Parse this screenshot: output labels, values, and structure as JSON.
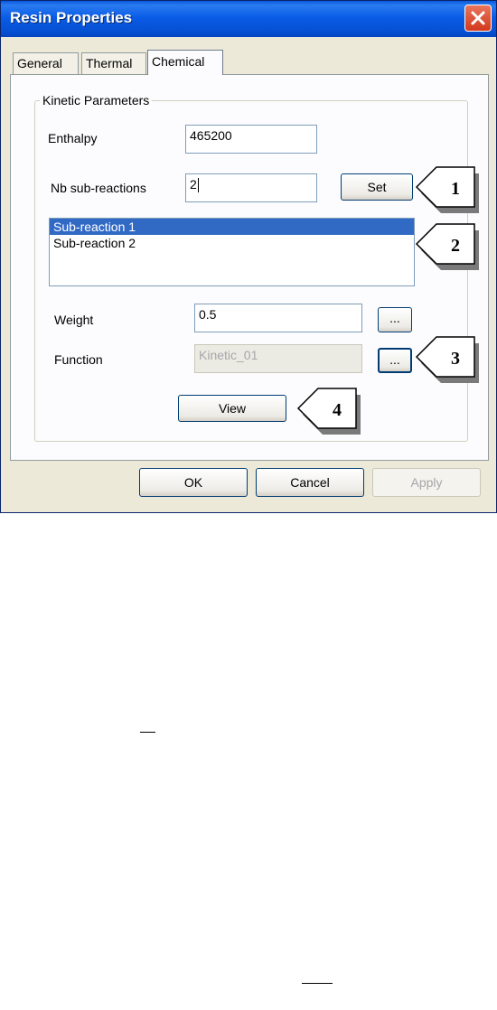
{
  "window": {
    "title": "Resin Properties"
  },
  "tabs": [
    {
      "label": "General"
    },
    {
      "label": "Thermal"
    },
    {
      "label": "Chemical",
      "active": true
    }
  ],
  "group": {
    "label": "Kinetic Parameters"
  },
  "fields": {
    "enthalpy_label": "Enthalpy",
    "enthalpy_value": "465200",
    "nb_label": "Nb sub-reactions",
    "nb_value": "2",
    "set_label": "Set",
    "weight_label": "Weight",
    "weight_value": "0.5",
    "weight_browse": "...",
    "function_label": "Function",
    "function_value": "Kinetic_01",
    "function_browse": "...",
    "view_label": "View"
  },
  "subreactions": [
    {
      "label": "Sub-reaction 1",
      "selected": true
    },
    {
      "label": "Sub-reaction 2",
      "selected": false
    }
  ],
  "footer": {
    "ok": "OK",
    "cancel": "Cancel",
    "apply": "Apply"
  },
  "callouts": [
    "1",
    "2",
    "3",
    "4"
  ]
}
